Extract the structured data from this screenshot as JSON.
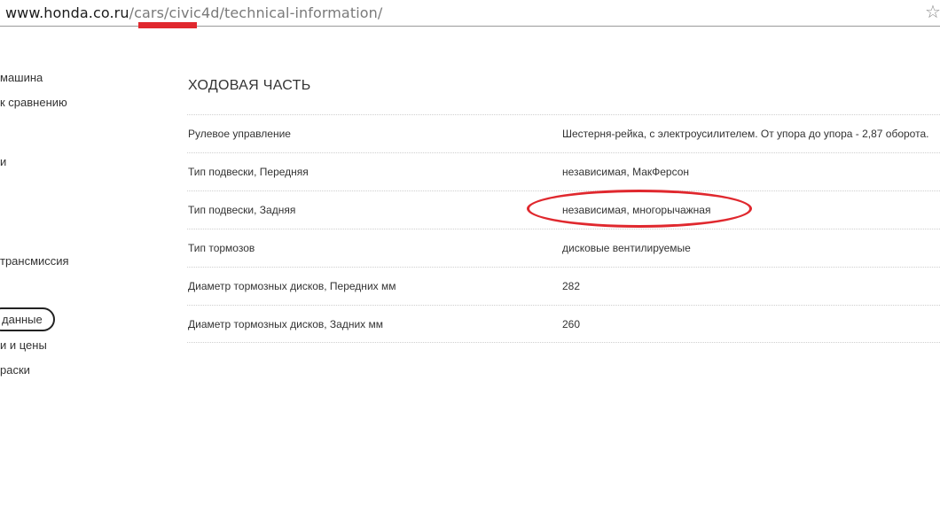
{
  "browser": {
    "url_domain": "www.honda.co.ru",
    "url_path": "/cars/civic4d/technical-information/",
    "bookmark_icon": "star-icon"
  },
  "sidebar": {
    "items": [
      {
        "label": "машина",
        "active": false
      },
      {
        "label": "к сравнению",
        "active": false
      },
      {
        "label": "и",
        "active": false
      },
      {
        "label": "трансмиссия",
        "active": false
      },
      {
        "label": "данные",
        "active": true
      },
      {
        "label": "и и цены",
        "active": false
      },
      {
        "label": "раски",
        "active": false
      }
    ]
  },
  "main": {
    "section_title": "ХОДОВАЯ ЧАСТЬ",
    "rows": [
      {
        "label": "Рулевое управление",
        "value": "Шестерня-рейка, с электроусилителем. От упора до упора - 2,87 оборота."
      },
      {
        "label": "Тип подвески, Передняя",
        "value": "независимая, МакФерсон"
      },
      {
        "label": "Тип подвески, Задняя",
        "value": "независимая, многорычажная"
      },
      {
        "label": "Тип тормозов",
        "value": "дисковые вентилируемые"
      },
      {
        "label": "Диаметр тормозных дисков, Передних мм",
        "value": "282"
      },
      {
        "label": "Диаметр тормозных дисков, Задних мм",
        "value": "260"
      }
    ]
  },
  "annotations": {
    "highlight_color": "#e0282e"
  }
}
